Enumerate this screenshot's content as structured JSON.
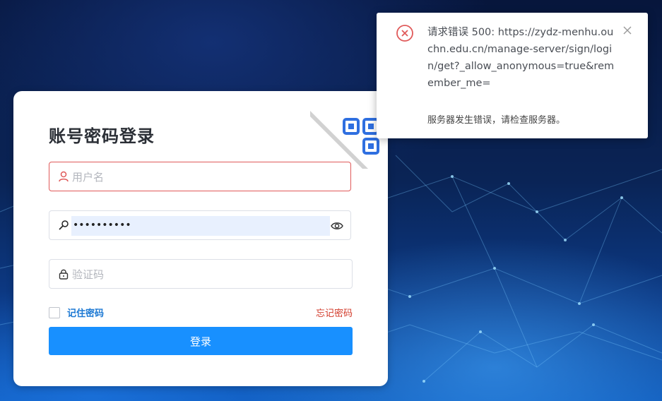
{
  "login": {
    "title": "账号密码登录",
    "username_placeholder": "用户名",
    "password_value": "••••••••••",
    "captcha_placeholder": "验证码",
    "remember_label": "记住密码",
    "forgot_label": "忘记密码",
    "login_button": "登录"
  },
  "toast": {
    "message": "请求错误 500: https://zydz-menhu.ouchn.edu.cn/manage-server/sign/login/get?_allow_anonymous=true&remember_me=",
    "description": "服务器发生错误，请检查服务器。"
  },
  "colors": {
    "primary": "#1890ff",
    "error": "#e05a5a",
    "forgot": "#d23a2a",
    "remember": "#1b78d3",
    "qr_blue": "#2f6fe0"
  },
  "icons": {
    "username": "user-icon",
    "password": "key-icon",
    "captcha": "lock-icon",
    "toggle": "eye-icon",
    "qr": "qr-code-icon",
    "toast_error": "error-circle-icon",
    "toast_close": "close-icon"
  }
}
